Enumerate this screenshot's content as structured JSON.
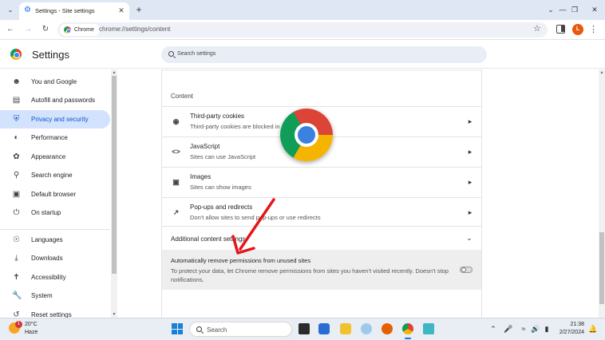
{
  "browser": {
    "tab_title": "Settings - Site settings",
    "url": "chrome://settings/content",
    "chip_label": "Chrome",
    "profile_initial": "L"
  },
  "header": {
    "title": "Settings",
    "search_placeholder": "Search settings"
  },
  "sidebar": {
    "items": [
      {
        "label": "You and Google",
        "icon": "person-icon"
      },
      {
        "label": "Autofill and passwords",
        "icon": "clipboard-icon"
      },
      {
        "label": "Privacy and security",
        "icon": "shield-icon",
        "active": true
      },
      {
        "label": "Performance",
        "icon": "speedometer-icon"
      },
      {
        "label": "Appearance",
        "icon": "palette-icon"
      },
      {
        "label": "Search engine",
        "icon": "search-icon"
      },
      {
        "label": "Default browser",
        "icon": "browser-icon"
      },
      {
        "label": "On startup",
        "icon": "power-icon"
      },
      {
        "label": "Languages",
        "icon": "globe-icon"
      },
      {
        "label": "Downloads",
        "icon": "download-icon"
      },
      {
        "label": "Accessibility",
        "icon": "accessibility-icon"
      },
      {
        "label": "System",
        "icon": "wrench-icon"
      },
      {
        "label": "Reset settings",
        "icon": "reset-icon"
      }
    ]
  },
  "content": {
    "heading": "Content",
    "rows": [
      {
        "title": "Third-party cookies",
        "subtitle": "Third-party cookies are blocked in",
        "icon": "cookie-icon"
      },
      {
        "title": "JavaScript",
        "subtitle": "Sites can use JavaScript",
        "icon": "code-icon"
      },
      {
        "title": "Images",
        "subtitle": "Sites can show images",
        "icon": "image-icon"
      },
      {
        "title": "Pop-ups and redirects",
        "subtitle": "Don't allow sites to send pop-ups or use redirects",
        "icon": "open-in-new-icon"
      }
    ],
    "additional_label": "Additional content settings",
    "auto_remove": {
      "title": "Automatically remove permissions from unused sites",
      "description": "To protect your data, let Chrome remove permissions from sites you haven't visited recently. Doesn't stop notifications.",
      "enabled": false
    }
  },
  "taskbar": {
    "weather_temp": "20°C",
    "weather_condition": "Haze",
    "weather_badge": "1",
    "search_label": "Search",
    "time": "21:38",
    "date": "2/27/2024"
  },
  "colors": {
    "accent": "#0b57d0",
    "active_nav_bg": "#d3e3fd",
    "annotation_arrow": "#e3161c",
    "profile": "#e8590c"
  }
}
